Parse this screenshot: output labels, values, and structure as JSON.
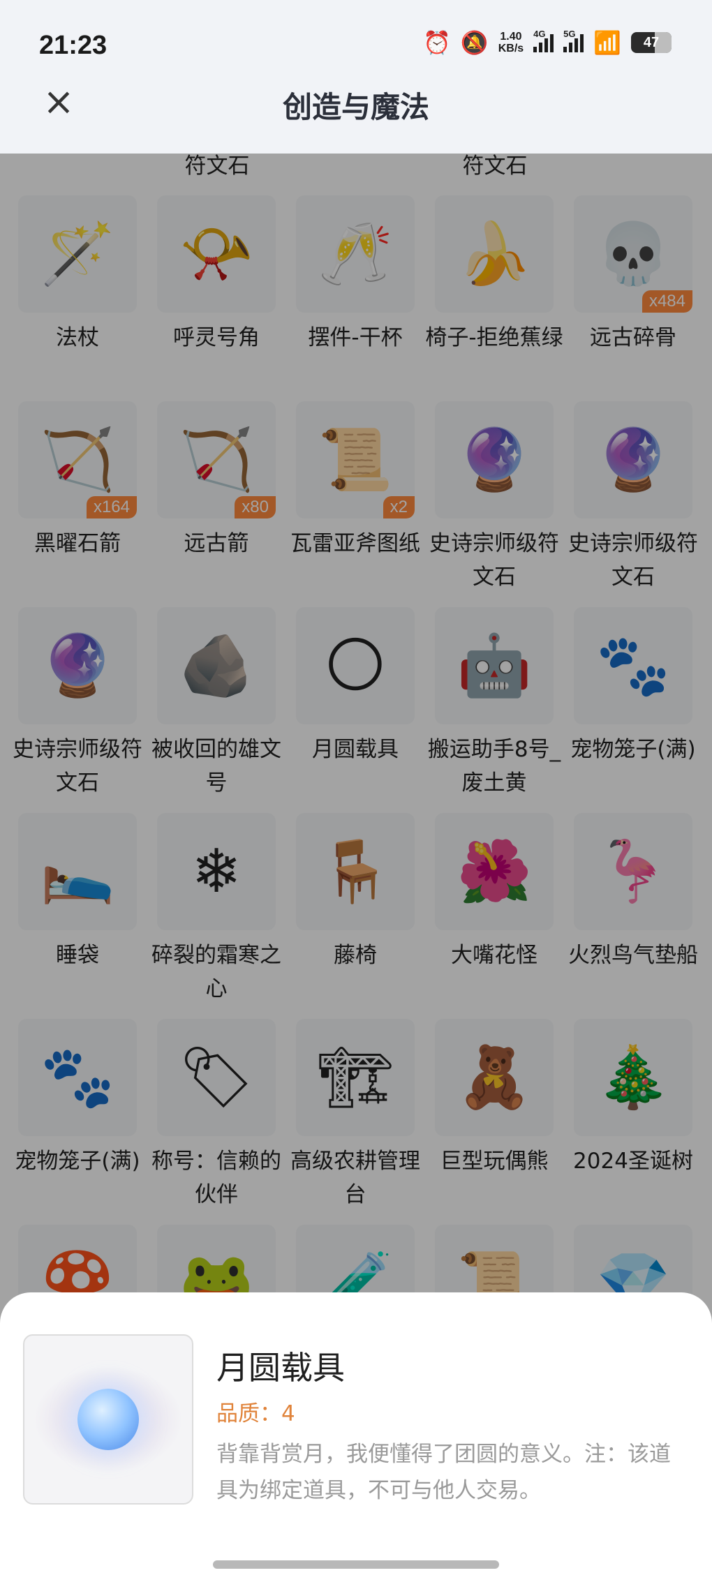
{
  "status_bar": {
    "time": "21:23",
    "net_speed_value": "1.40",
    "net_speed_unit": "KB/s",
    "sig1_label": "4G",
    "sig2_label": "5G",
    "battery": "47",
    "icons": [
      "alarm-icon",
      "mute-bell-icon",
      "signal-4g-icon",
      "signal-5g-icon",
      "wifi-icon",
      "battery-icon"
    ]
  },
  "header": {
    "title": "创造与魔法",
    "close_icon": "×"
  },
  "top_labels": [
    "符文石",
    "符文石"
  ],
  "items": [
    {
      "name": "法杖",
      "glyph": "🪄",
      "qty": ""
    },
    {
      "name": "呼灵号角",
      "glyph": "📯",
      "qty": ""
    },
    {
      "name": "摆件-干杯",
      "glyph": "🥂",
      "qty": ""
    },
    {
      "name": "椅子-拒绝蕉绿",
      "glyph": "🍌",
      "qty": ""
    },
    {
      "name": "远古碎骨",
      "glyph": "💀",
      "qty": "x484"
    },
    {
      "name": "黑曜石箭",
      "glyph": "🏹",
      "qty": "x164"
    },
    {
      "name": "远古箭",
      "glyph": "🏹",
      "qty": "x80"
    },
    {
      "name": "瓦雷亚斧图纸",
      "glyph": "📜",
      "qty": "x2"
    },
    {
      "name": "史诗宗师级符文石",
      "glyph": "🔮",
      "qty": ""
    },
    {
      "name": "史诗宗师级符文石",
      "glyph": "🔮",
      "qty": ""
    },
    {
      "name": "史诗宗师级符文石",
      "glyph": "🔮",
      "qty": ""
    },
    {
      "name": "被收回的雄文号",
      "glyph": "🪨",
      "qty": ""
    },
    {
      "name": "月圆载具",
      "glyph": "🌕",
      "qty": ""
    },
    {
      "name": "搬运助手8号_废土黄",
      "glyph": "🤖",
      "qty": ""
    },
    {
      "name": "宠物笼子(满)",
      "glyph": "🐾",
      "qty": ""
    },
    {
      "name": "睡袋",
      "glyph": "🛌",
      "qty": ""
    },
    {
      "name": "碎裂的霜寒之心",
      "glyph": "❄",
      "qty": ""
    },
    {
      "name": "藤椅",
      "glyph": "🪑",
      "qty": ""
    },
    {
      "name": "大嘴花怪",
      "glyph": "🌺",
      "qty": ""
    },
    {
      "name": "火烈鸟气垫船",
      "glyph": "🦩",
      "qty": ""
    },
    {
      "name": "宠物笼子(满)",
      "glyph": "🐾",
      "qty": ""
    },
    {
      "name": "称号：信赖的伙伴",
      "glyph": "🏷",
      "qty": ""
    },
    {
      "name": "高级农耕管理台",
      "glyph": "🏗",
      "qty": ""
    },
    {
      "name": "巨型玩偶熊",
      "glyph": "🧸",
      "qty": ""
    },
    {
      "name": "2024圣诞树",
      "glyph": "🎄",
      "qty": ""
    },
    {
      "name": "",
      "glyph": "🍄",
      "qty": ""
    },
    {
      "name": "",
      "glyph": "🐸",
      "qty": ""
    },
    {
      "name": "",
      "glyph": "🧪",
      "qty": ""
    },
    {
      "name": "",
      "glyph": "📜",
      "qty": ""
    },
    {
      "name": "",
      "glyph": "💎",
      "qty": ""
    }
  ],
  "detail": {
    "title": "月圆载具",
    "quality": "品质：4",
    "description": "背靠背赏月，我便懂得了团圆的意义。注：该道具为绑定道具，不可与他人交易。"
  }
}
